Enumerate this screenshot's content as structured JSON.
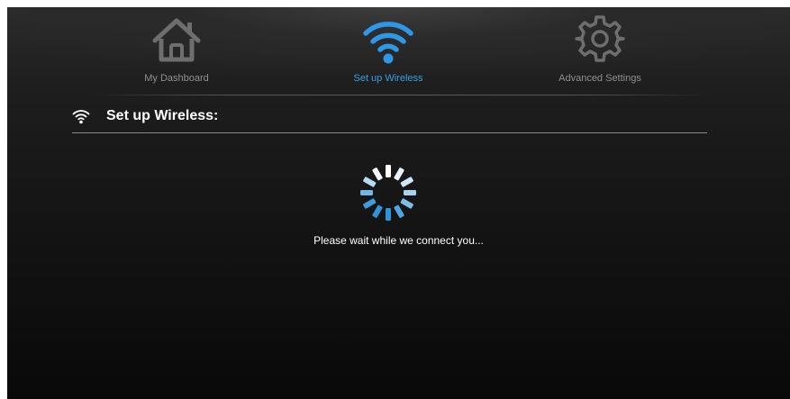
{
  "nav": {
    "tabs": [
      {
        "label": "My Dashboard",
        "icon": "home-icon",
        "active": false
      },
      {
        "label": "Set up Wireless",
        "icon": "wifi-icon",
        "active": true
      },
      {
        "label": "Advanced Settings",
        "icon": "gear-icon",
        "active": false
      }
    ]
  },
  "section": {
    "title": "Set up Wireless:",
    "icon": "wifi-icon"
  },
  "status": {
    "message": "Please wait while we connect you...",
    "icon": "loading-spinner-icon"
  },
  "colors": {
    "accent": "#3a9fe4",
    "inactive": "#8f8f8f",
    "text": "#ffffff"
  }
}
